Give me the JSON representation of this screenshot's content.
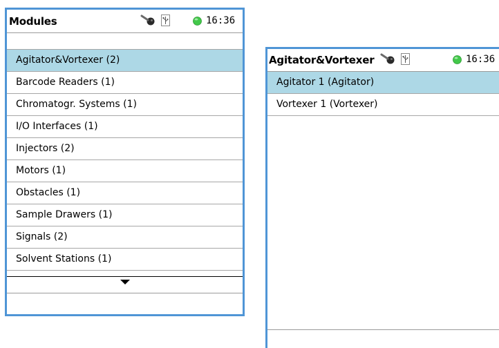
{
  "modules_screen": {
    "title": "Modules",
    "time": "16:36",
    "status_led_color": "#43c84a",
    "icons": [
      "key-icon",
      "usb-icon",
      "status-led-icon"
    ],
    "items": [
      {
        "label": "Agitator&Vortexer (2)",
        "selected": true
      },
      {
        "label": "Barcode Readers (1)"
      },
      {
        "label": "Chromatogr. Systems (1)"
      },
      {
        "label": "I/O Interfaces (1)"
      },
      {
        "label": "Injectors (2)"
      },
      {
        "label": "Motors (1)"
      },
      {
        "label": "Obstacles (1)"
      },
      {
        "label": "Sample Drawers (1)"
      },
      {
        "label": "Signals (2)"
      },
      {
        "label": "Solvent Stations (1)"
      }
    ],
    "scroll_icon": "arrow-down-icon"
  },
  "detail_screen": {
    "title": "Agitator&Vortexer",
    "time": "16:36",
    "status_led_color": "#43c84a",
    "icons": [
      "key-icon",
      "usb-icon",
      "status-led-icon"
    ],
    "items": [
      {
        "label": "Agitator 1 (Agitator)",
        "selected": true
      },
      {
        "label": "Vortexer 1 (Vortexer)"
      }
    ]
  },
  "colors": {
    "frame_border": "#4f95d6",
    "selected_row": "#add8e6",
    "row_divider": "#a6a6a6"
  }
}
